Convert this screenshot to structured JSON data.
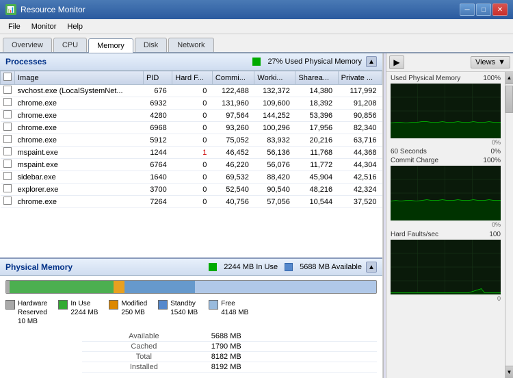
{
  "titleBar": {
    "title": "Resource Monitor",
    "icon": "📊",
    "minBtn": "─",
    "maxBtn": "□",
    "closeBtn": "✕"
  },
  "menuBar": {
    "items": [
      "File",
      "Monitor",
      "Help"
    ]
  },
  "tabs": {
    "items": [
      "Overview",
      "CPU",
      "Memory",
      "Disk",
      "Network"
    ],
    "active": "Memory"
  },
  "processes": {
    "title": "Processes",
    "info": "27% Used Physical Memory",
    "columns": [
      "",
      "Image",
      "PID",
      "Hard F...",
      "Commi...",
      "Worki...",
      "Sharea...",
      "Private ..."
    ],
    "rows": [
      [
        "",
        "svchost.exe (LocalSystemNet...",
        "676",
        "0",
        "122,488",
        "132,372",
        "14,380",
        "117,992"
      ],
      [
        "",
        "chrome.exe",
        "6932",
        "0",
        "131,960",
        "109,600",
        "18,392",
        "91,208"
      ],
      [
        "",
        "chrome.exe",
        "4280",
        "0",
        "97,564",
        "144,252",
        "53,396",
        "90,856"
      ],
      [
        "",
        "chrome.exe",
        "6968",
        "0",
        "93,260",
        "100,296",
        "17,956",
        "82,340"
      ],
      [
        "",
        "chrome.exe",
        "5912",
        "0",
        "75,052",
        "83,932",
        "20,216",
        "63,716"
      ],
      [
        "",
        "mspaint.exe",
        "1244",
        "1",
        "46,452",
        "56,136",
        "11,768",
        "44,368"
      ],
      [
        "",
        "mspaint.exe",
        "6764",
        "0",
        "46,220",
        "56,076",
        "11,772",
        "44,304"
      ],
      [
        "",
        "sidebar.exe",
        "1640",
        "0",
        "69,532",
        "88,420",
        "45,904",
        "42,516"
      ],
      [
        "",
        "explorer.exe",
        "3700",
        "0",
        "52,540",
        "90,540",
        "48,216",
        "42,324"
      ],
      [
        "",
        "chrome.exe",
        "7264",
        "0",
        "40,756",
        "57,056",
        "10,544",
        "37,520"
      ]
    ]
  },
  "physicalMemory": {
    "title": "Physical Memory",
    "inUseLabel": "2244 MB In Use",
    "availableLabel": "5688 MB Available",
    "bars": {
      "hwReservedPct": 1,
      "inUsePct": 28,
      "modifiedPct": 3,
      "standbyPct": 19,
      "freePct": 49
    },
    "legend": [
      {
        "label": "Hardware\nReserved\n10 MB",
        "color": "#aaaaaa"
      },
      {
        "label": "In Use\n2244 MB",
        "color": "#33aa33"
      },
      {
        "label": "Modified\n250 MB",
        "color": "#dd8800"
      },
      {
        "label": "Standby\n1540 MB",
        "color": "#5588cc"
      },
      {
        "label": "Free\n4148 MB",
        "color": "#99bbdd"
      }
    ],
    "stats": [
      {
        "label": "Available",
        "value": "5688 MB"
      },
      {
        "label": "Cached",
        "value": "1790 MB"
      },
      {
        "label": "Total",
        "value": "8182 MB"
      },
      {
        "label": "Installed",
        "value": "8192 MB"
      }
    ]
  },
  "rightPanel": {
    "navBtn": "▶",
    "viewsLabel": "Views",
    "graphs": [
      {
        "label": "Used Physical Memory",
        "pctTop": "100%",
        "pctBottom": "0%"
      },
      {
        "label": "60 Seconds",
        "extra": "0%",
        "subLabel": "Commit Charge",
        "subPct": "100%"
      },
      {
        "label": "Hard Faults/sec",
        "max": "100",
        "bottom": "0"
      }
    ]
  }
}
